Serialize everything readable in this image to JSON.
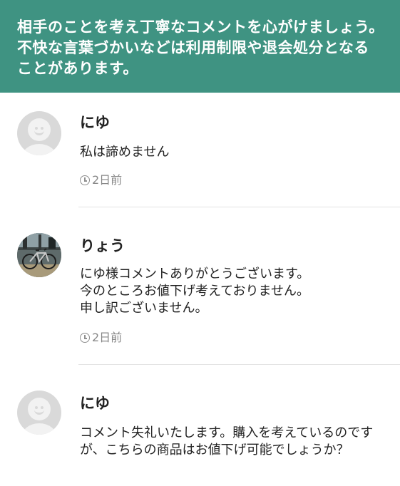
{
  "notice": {
    "text": "相手のことを考え丁寧なコメントを心がけましょう。不快な言葉づかいなどは利用制限や退会処分となることがあります。"
  },
  "comments": [
    {
      "name": "にゆ",
      "text": "私は諦めません",
      "time": "2日前",
      "avatar": "default-avatar-icon"
    },
    {
      "name": "りょう",
      "text": "にゆ様コメントありがとうございます。\n今のところお値下げ考えておりません。\n申し訳ございません。",
      "time": "2日前",
      "avatar": "bicycle-photo"
    },
    {
      "name": "にゆ",
      "text": "コメント失礼いたします。購入を考えているのですが、こちらの商品はお値下げ可能でしょうか？",
      "time": "",
      "avatar": "default-avatar-icon"
    }
  ],
  "colors": {
    "notice_bg": "#3f9382",
    "divider": "#e4e4e4",
    "meta_text": "#888888"
  }
}
